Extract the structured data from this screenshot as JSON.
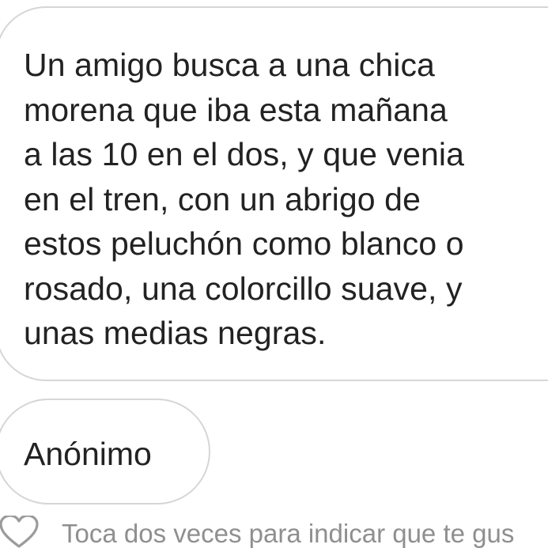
{
  "message": {
    "text": "Un amigo busca a una chica\nmorena que iba esta mañana\na las 10 en el dos, y que venia\nen el tren,  con un abrigo de\nestos peluchón como blanco o\nrosado, una colorcillo suave, y\nunas medias negras."
  },
  "sender": {
    "name": "Anónimo"
  },
  "footer": {
    "like_icon": "heart-outline-icon",
    "hint": "Toca dos veces para indicar que te gus"
  },
  "colors": {
    "text": "#222222",
    "bubble_border": "#d6d6d6",
    "hint_text": "#8f8f8f",
    "icon": "#9b9b9b",
    "background": "#ffffff"
  }
}
